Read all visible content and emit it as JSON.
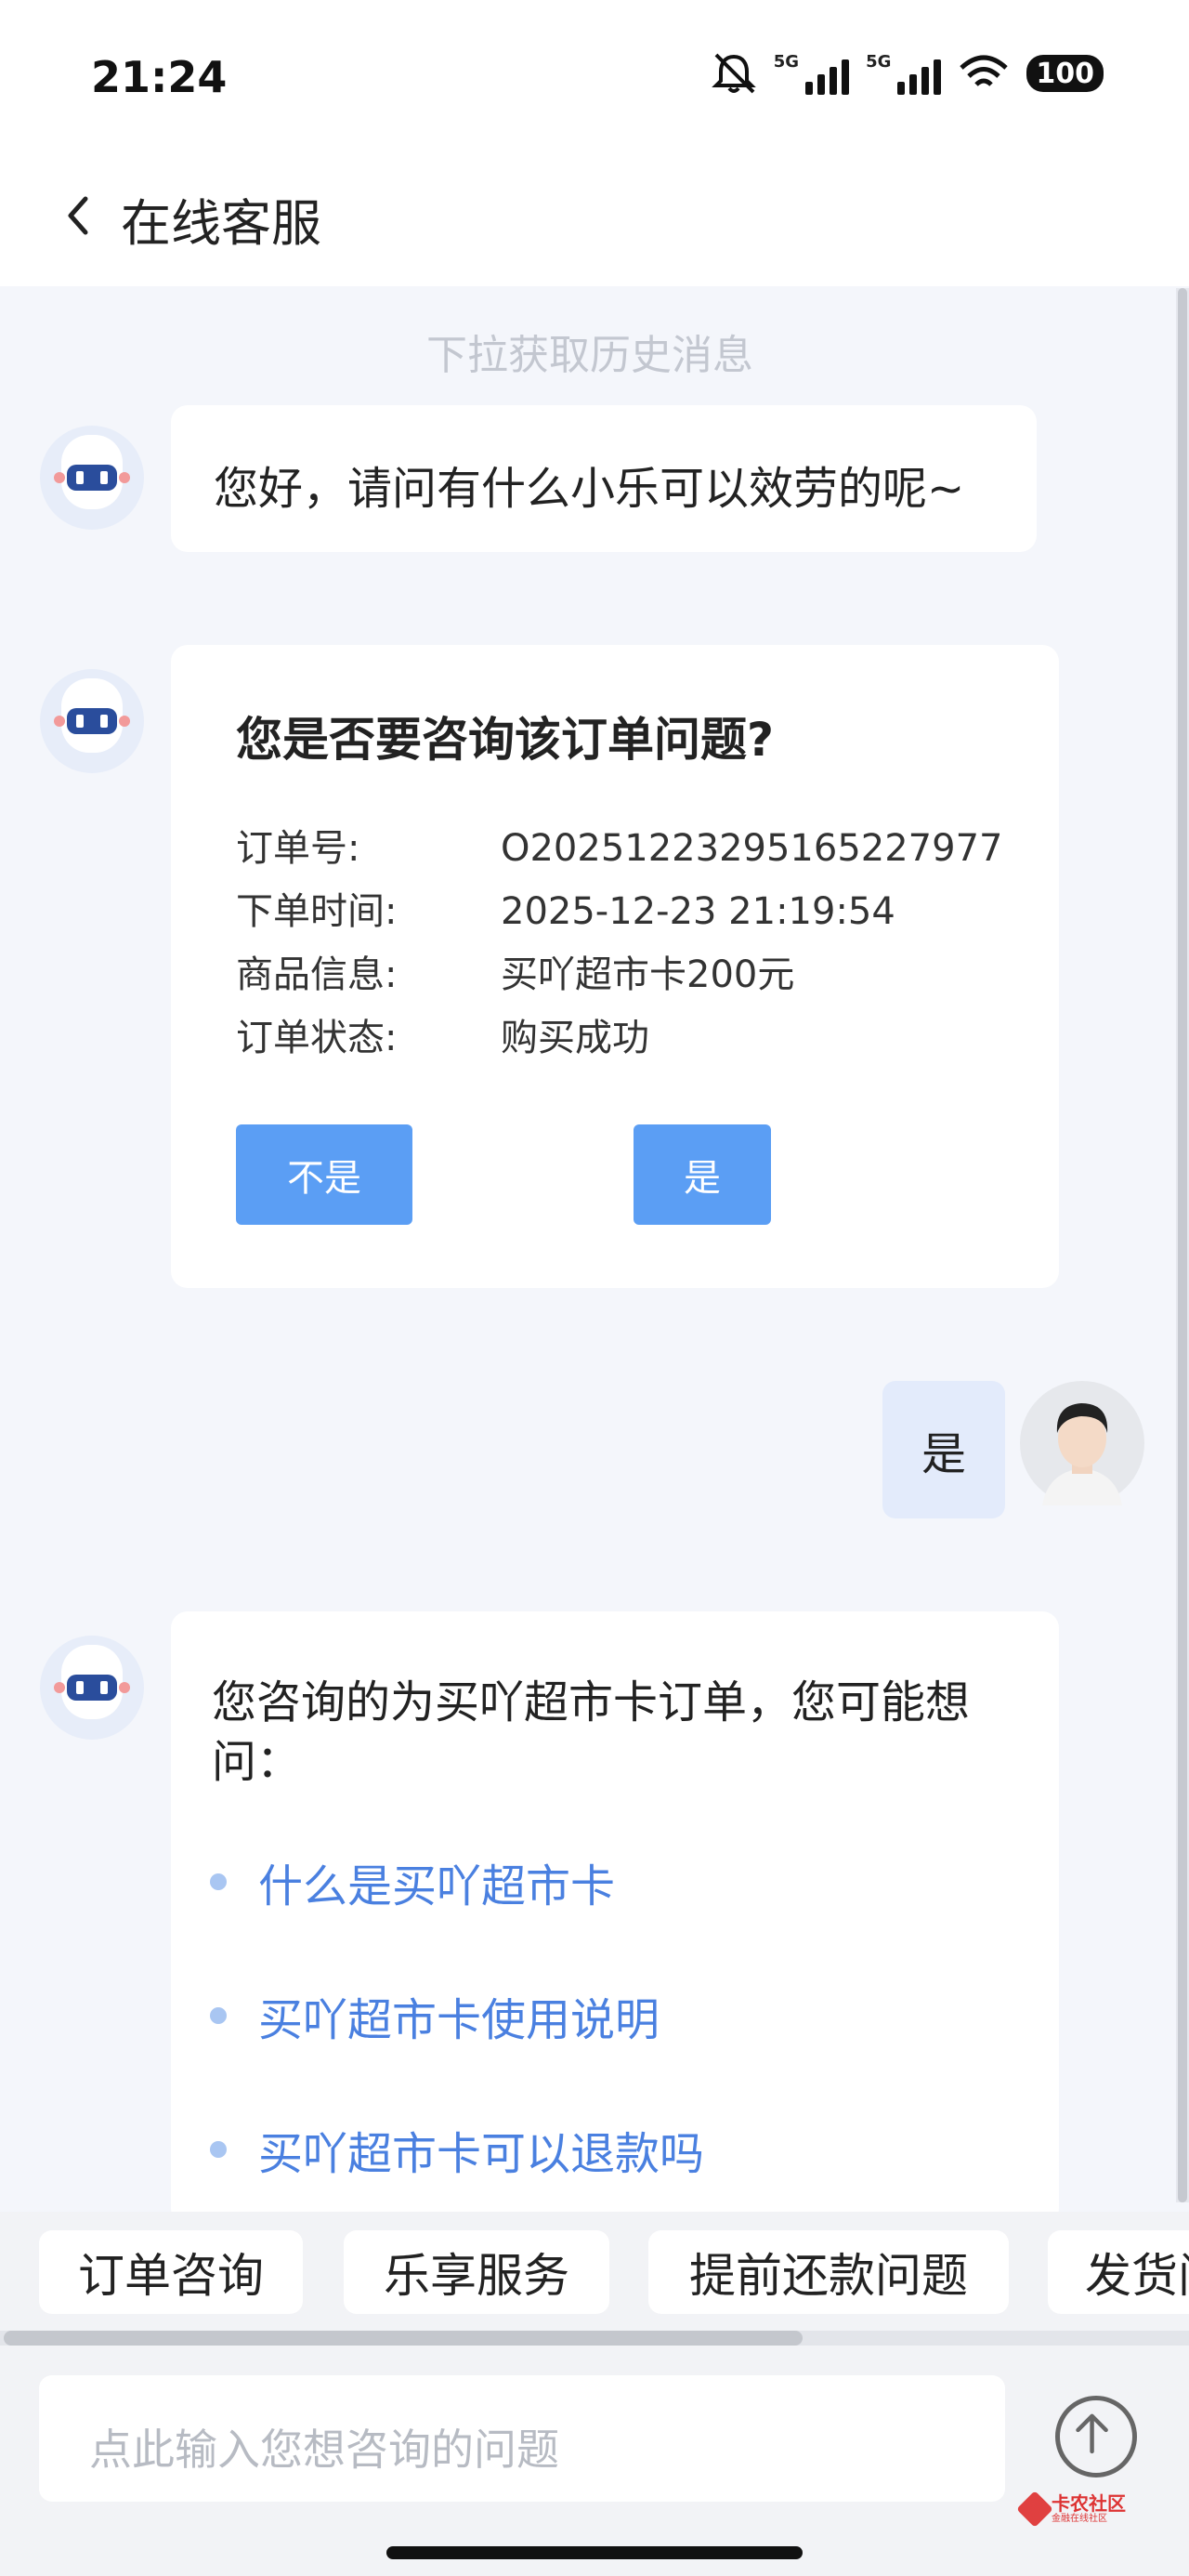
{
  "status_bar": {
    "time": "21:24",
    "network_1": "5G",
    "network_2": "5G",
    "battery": "100",
    "icons": [
      "mute-icon",
      "signal-icon",
      "signal-icon",
      "wifi-icon",
      "battery-icon"
    ]
  },
  "nav": {
    "back_icon": "chevron-left-icon",
    "title": "在线客服"
  },
  "chat": {
    "history_hint": "下拉获取历史消息",
    "greeting": "您好，请问有什么小乐可以效劳的呢~",
    "order_card": {
      "title": "您是否要咨询该订单问题?",
      "rows": [
        {
          "label": "订单号:",
          "value": "O2025122329516522797​7"
        },
        {
          "label": "下单时间:",
          "value": "2025-12-23 21:19:54"
        },
        {
          "label": "商品信息:",
          "value": "买吖超市卡200元"
        },
        {
          "label": "订单状态:",
          "value": "购买成功"
        }
      ],
      "no_label": "不是",
      "yes_label": "是"
    },
    "user_reply": "是",
    "faq_card": {
      "title": "您咨询的为买吖超市卡订单，您可能想问：",
      "items": [
        "什么是买吖超市卡",
        "买吖超市卡使用说明",
        "买吖超市卡可以退款吗"
      ]
    }
  },
  "quick_replies": [
    "订单咨询",
    "乐享服务",
    "提前还款问题",
    "发货问"
  ],
  "input": {
    "placeholder": "点此输入您想咨询的问题",
    "send_icon": "arrow-up-circle-icon"
  },
  "watermark": {
    "main": "卡农社区",
    "sub": "金融在线社区"
  },
  "colors": {
    "accent": "#5b9ef4",
    "link": "#4a80e0",
    "background": "#f4f6fb",
    "user_bubble": "#e3ebfb"
  }
}
